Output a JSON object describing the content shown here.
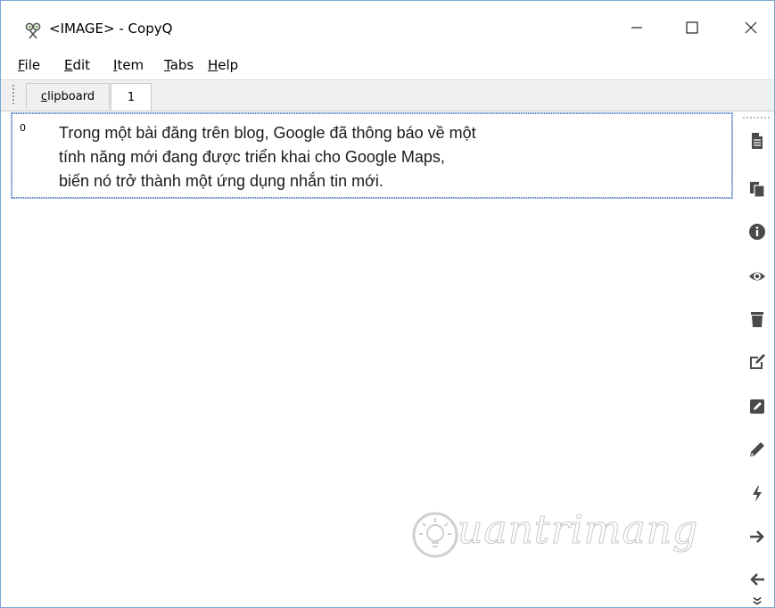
{
  "window": {
    "title": "<IMAGE> - CopyQ",
    "minimize_symbol": "—",
    "maximize_symbol": "☐",
    "close_symbol": "✕"
  },
  "menu": [
    "File",
    "Edit",
    "Item",
    "Tabs",
    "Help"
  ],
  "tabs": [
    {
      "label": "clipboard",
      "active": false
    },
    {
      "label": "1",
      "active": true
    }
  ],
  "items": [
    {
      "index": "0",
      "text": "Trong một bài đăng trên blog, Google đã thông báo về một\ntính năng mới đang được triển khai cho Google Maps,\nbiến nó trở thành một ứng dụng nhắn tin mới."
    }
  ],
  "toolbar": {
    "icons": [
      "new-item-icon",
      "copy-icon",
      "info-icon",
      "preview-icon",
      "delete-icon",
      "edit-icon",
      "edit-external-icon",
      "edit-pencil-icon",
      "commands-icon",
      "move-right-icon",
      "move-left-icon",
      "more-icon"
    ],
    "icon_color": "#4a4a4a"
  },
  "watermark": {
    "text": "uantrimang"
  },
  "colors": {
    "selection_border": "#3c68b5",
    "tab_bar_bg": "#f0f0f0",
    "window_border": "#7aa7d6"
  }
}
